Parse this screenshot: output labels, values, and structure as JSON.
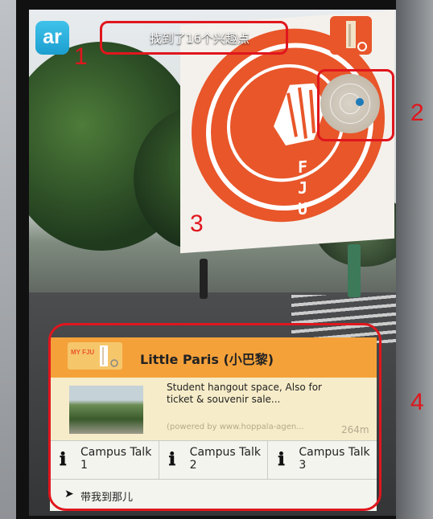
{
  "annotations": [
    "1",
    "2",
    "3",
    "4"
  ],
  "header": {
    "app_logo": "ar",
    "poi_count_text": "找到了16个兴趣点"
  },
  "ar_marker": {
    "letters": [
      "F",
      "J",
      "U"
    ]
  },
  "poi_card": {
    "badge_text": "MY FJU",
    "title": "Little Paris (小巴黎)",
    "description": "Student hangout space, Also for ticket & souvenir sale...",
    "powered_by": "(powered by www.hoppala-agen...",
    "distance": "264m",
    "actions": [
      {
        "label": "Campus Talk 1"
      },
      {
        "label": "Campus Talk 2"
      },
      {
        "label": "Campus Talk 3"
      }
    ],
    "navigate_label": "带我到那儿"
  },
  "colors": {
    "accent_orange": "#e8562a",
    "card_header": "#f4a13a",
    "annotation_red": "#e0161d",
    "logo_blue": "#1c9fd0"
  },
  "icons": [
    "ar-logo-icon",
    "radar-icon",
    "info-icon",
    "navigation-arrow-icon"
  ]
}
